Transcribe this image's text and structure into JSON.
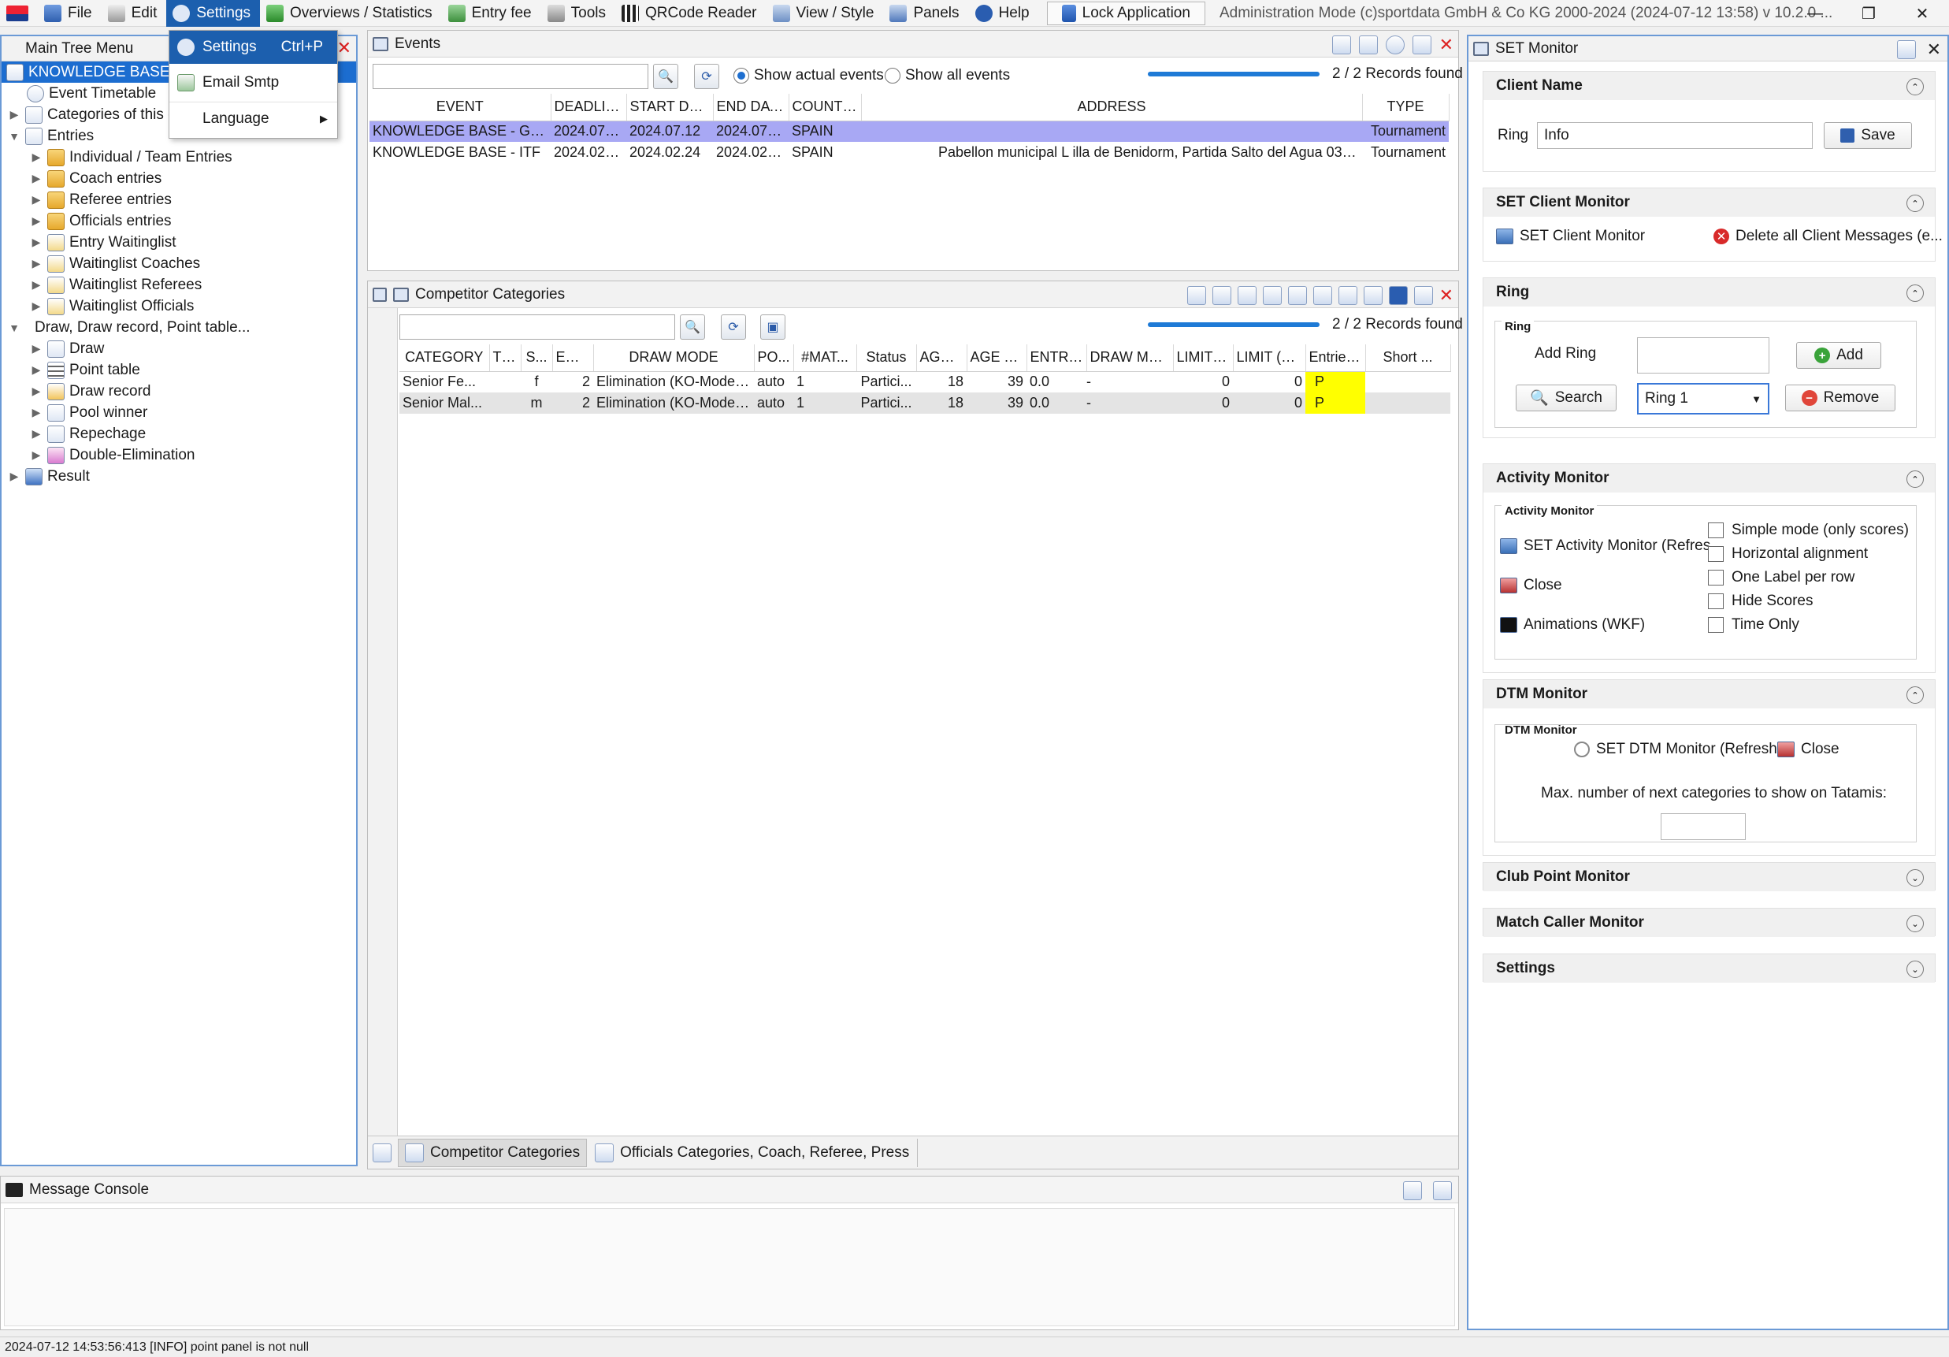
{
  "menubar": {
    "items": [
      {
        "label": "File"
      },
      {
        "label": "Edit"
      },
      {
        "label": "Settings"
      },
      {
        "label": "Overviews / Statistics"
      },
      {
        "label": "Entry fee"
      },
      {
        "label": "Tools"
      },
      {
        "label": "QRCode Reader"
      },
      {
        "label": "View / Style"
      },
      {
        "label": "Panels"
      },
      {
        "label": "Help"
      }
    ],
    "lock_label": "Lock Application",
    "title": "Administration Mode (c)sportdata GmbH & Co KG 2000-2024 (2024-07-12 13:58)  v 10.2.0 ..."
  },
  "settings_menu": {
    "items": [
      {
        "label": "Settings",
        "shortcut": "Ctrl+P"
      },
      {
        "label": "Email Smtp"
      },
      {
        "label": "Language"
      }
    ]
  },
  "tree": {
    "title": "Main Tree Menu",
    "rows": [
      {
        "label": "KNOWLEDGE BASE - G"
      },
      {
        "label": "Event Timetable"
      },
      {
        "label": "Categories of this e"
      },
      {
        "label": "Entries"
      },
      {
        "label": "Individual / Team Entries"
      },
      {
        "label": "Coach entries"
      },
      {
        "label": "Referee entries"
      },
      {
        "label": "Officials entries"
      },
      {
        "label": "Entry Waitinglist"
      },
      {
        "label": "Waitinglist Coaches"
      },
      {
        "label": "Waitinglist Referees"
      },
      {
        "label": "Waitinglist Officials"
      },
      {
        "label": "Draw, Draw record, Point table..."
      },
      {
        "label": "Draw"
      },
      {
        "label": "Point table"
      },
      {
        "label": "Draw record"
      },
      {
        "label": "Pool winner"
      },
      {
        "label": "Repechage"
      },
      {
        "label": "Double-Elimination"
      },
      {
        "label": "Result"
      }
    ]
  },
  "events": {
    "title": "Events",
    "radio_actual": "Show actual events",
    "radio_all": "Show all events",
    "records": "2 / 2 Records found",
    "columns": [
      "EVENT",
      "DEADLINE",
      "START DATE",
      "END DATE",
      "COUNTRY",
      "ADDRESS",
      "TYPE"
    ],
    "rows": [
      [
        "KNOWLEDGE BASE - GENE...",
        "2024.07.12",
        "2024.07.12",
        "2024.07.12",
        "SPAIN",
        "",
        "Tournament"
      ],
      [
        "KNOWLEDGE BASE - ITF",
        "2024.02.20",
        "2024.02.24",
        "2024.02.24",
        "SPAIN",
        "Pabellon municipal L illa de Benidorm, Partida Salto del Agua 03502 Benidorm...",
        "Tournament"
      ]
    ]
  },
  "categories": {
    "title": "Competitor Categories",
    "records": "2 / 2 Records found",
    "columns": [
      "CATEGORY",
      "TE...",
      "S...",
      "ENT...",
      "DRAW MODE",
      "PO...",
      "#MAT...",
      "Status",
      "AGE F...",
      "AGE TO...",
      "ENTRY ...",
      "DRAW MO...",
      "LIMIT (...",
      "LIMIT (CA...",
      "Entries...",
      "Short ..."
    ],
    "rows": [
      [
        "Senior Fe...",
        "",
        "f",
        "2",
        "Elimination (KO-Mode)...",
        "auto",
        "1",
        "Partici...",
        "18",
        "39",
        "0.0",
        "-",
        "0",
        "0",
        "P",
        ""
      ],
      [
        "Senior Mal...",
        "",
        "m",
        "2",
        "Elimination (KO-Mode)...",
        "auto",
        "1",
        "Partici...",
        "18",
        "39",
        "0.0",
        "-",
        "0",
        "0",
        "P",
        ""
      ]
    ],
    "tabs": [
      {
        "label": "Competitor Categories"
      },
      {
        "label": "Officials Categories, Coach, Referee, Press"
      }
    ]
  },
  "console": {
    "title": "Message Console"
  },
  "status": {
    "text": "2024-07-12 14:53:56:413 [INFO] point panel is not null"
  },
  "monitor": {
    "title": "SET Monitor",
    "client_name": {
      "header": "Client Name",
      "ring_label": "Ring",
      "ring_value": "Info",
      "save_label": "Save"
    },
    "client_monitor": {
      "header": "SET Client Monitor",
      "monitor_label": "SET Client Monitor",
      "delete_label": "Delete all Client Messages (e..."
    },
    "ring": {
      "header": "Ring",
      "group_title": "Ring",
      "add_ring_label": "Add Ring",
      "add_ring_value": "",
      "add_label": "Add",
      "search_label": "Search",
      "ring_select": "Ring 1",
      "remove_label": "Remove"
    },
    "activity": {
      "header": "Activity Monitor",
      "group_title": "Activity Monitor",
      "monitor_label": "SET Activity Monitor (Refres...",
      "close_label": "Close",
      "animations_label": "Animations (WKF)",
      "checks": [
        {
          "label": "Simple mode (only scores)",
          "checked": false
        },
        {
          "label": "Horizontal alignment",
          "checked": false
        },
        {
          "label": "One Label per row",
          "checked": false
        },
        {
          "label": "Hide Scores",
          "checked": false
        },
        {
          "label": "Time Only",
          "checked": false
        }
      ]
    },
    "dtm": {
      "header": "DTM Monitor",
      "group_title": "DTM Monitor",
      "monitor_label": "SET DTM Monitor (Refresh)",
      "close_label": "Close",
      "max_label": "Max. number of next categories to show on Tatamis:"
    },
    "collapsed": [
      {
        "label": "Club Point Monitor"
      },
      {
        "label": "Match Caller Monitor"
      },
      {
        "label": "Settings"
      }
    ]
  }
}
